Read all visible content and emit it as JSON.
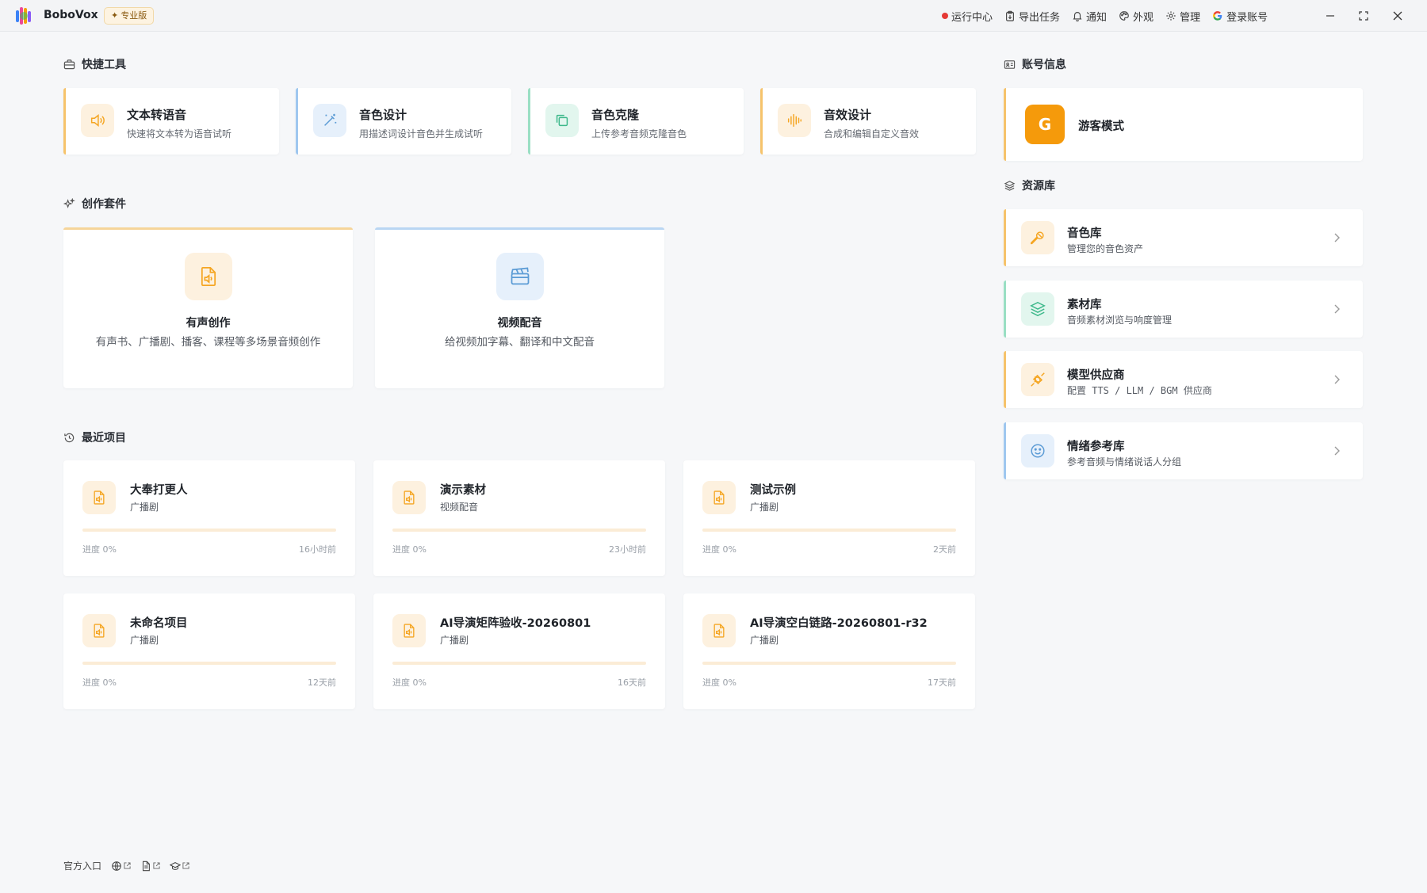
{
  "app": {
    "name": "BoboVox",
    "badge": "专业版"
  },
  "top_nav": {
    "run_center": "运行中心",
    "export_tasks": "导出任务",
    "notifications": "通知",
    "appearance": "外观",
    "admin": "管理",
    "login": "登录账号"
  },
  "sections": {
    "quick_tools": "快捷工具",
    "creation_suite": "创作套件",
    "recent_projects": "最近项目",
    "account_info": "账号信息",
    "resource_library": "资源库"
  },
  "quick_tools": [
    {
      "title": "文本转语音",
      "desc": "快速将文本转为语音试听",
      "accent": "#f6c36b"
    },
    {
      "title": "音色设计",
      "desc": "用描述词设计音色并生成试听",
      "accent": "#9fc7ef"
    },
    {
      "title": "音色克隆",
      "desc": "上传参考音频克隆音色",
      "accent": "#9adfc4"
    },
    {
      "title": "音效设计",
      "desc": "合成和编辑自定义音效",
      "accent": "#f6c36b"
    }
  ],
  "creation_suite": [
    {
      "title": "有声创作",
      "desc": "有声书、广播剧、播客、课程等多场景音频创作"
    },
    {
      "title": "视频配音",
      "desc": "给视频加字幕、翻译和中文配音"
    }
  ],
  "recent_projects": [
    {
      "name": "大奉打更人",
      "type": "广播剧",
      "progress_label": "进度 0%",
      "progress": 0,
      "time": "16小时前"
    },
    {
      "name": "演示素材",
      "type": "视频配音",
      "progress_label": "进度 0%",
      "progress": 0,
      "time": "23小时前"
    },
    {
      "name": "测试示例",
      "type": "广播剧",
      "progress_label": "进度 0%",
      "progress": 0,
      "time": "2天前"
    },
    {
      "name": "未命名项目",
      "type": "广播剧",
      "progress_label": "进度 0%",
      "progress": 0,
      "time": "12天前"
    },
    {
      "name": "AI导演矩阵验收-20260801",
      "type": "广播剧",
      "progress_label": "进度 0%",
      "progress": 0,
      "time": "16天前"
    },
    {
      "name": "AI导演空白链路-20260801-r32",
      "type": "广播剧",
      "progress_label": "进度 0%",
      "progress": 0,
      "time": "17天前"
    }
  ],
  "account": {
    "avatar_letter": "G",
    "mode": "游客模式"
  },
  "resources": [
    {
      "title": "音色库",
      "desc": "管理您的音色资产"
    },
    {
      "title": "素材库",
      "desc": "音频素材浏览与响度管理"
    },
    {
      "title": "模型供应商",
      "desc": "配置 TTS / LLM / BGM 供应商"
    },
    {
      "title": "情绪参考库",
      "desc": "参考音频与情绪说话人分组"
    }
  ],
  "footer": {
    "official_entry": "官方入口"
  },
  "colors": {
    "accent_orange": "#f5a623",
    "accent_blue": "#5b9bd5",
    "accent_green": "#3cb88a",
    "status_red": "#e53935"
  }
}
